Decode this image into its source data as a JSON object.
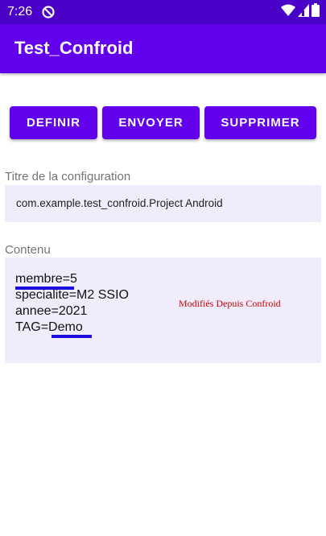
{
  "status_bar": {
    "time": "7:26",
    "app_icon": "notification-app-icon",
    "icons": [
      "wifi-icon",
      "signal-icon",
      "battery-icon"
    ]
  },
  "app_bar": {
    "title": "Test_Confroid"
  },
  "buttons": {
    "definir": "DEFINIR",
    "envoyer": "ENVOYER",
    "supprimer": "SUPPRIMER"
  },
  "titre": {
    "label": "Titre de la configuration",
    "value": "com.example.test_confroid.Project Android"
  },
  "contenu": {
    "label": "Contenu",
    "lines": [
      "membre=5",
      "specialite=M2 SSIO",
      "annee=2021",
      "TAG=Demo"
    ],
    "note": "Modifiés Depuis Confroid"
  },
  "colors": {
    "status_bar": "#4B00C8",
    "app_bar": "#6200EE",
    "button": "#6200EE",
    "field_bg": "#F1ECFB",
    "underline": "#1A0DE0",
    "note": "#D00000"
  }
}
